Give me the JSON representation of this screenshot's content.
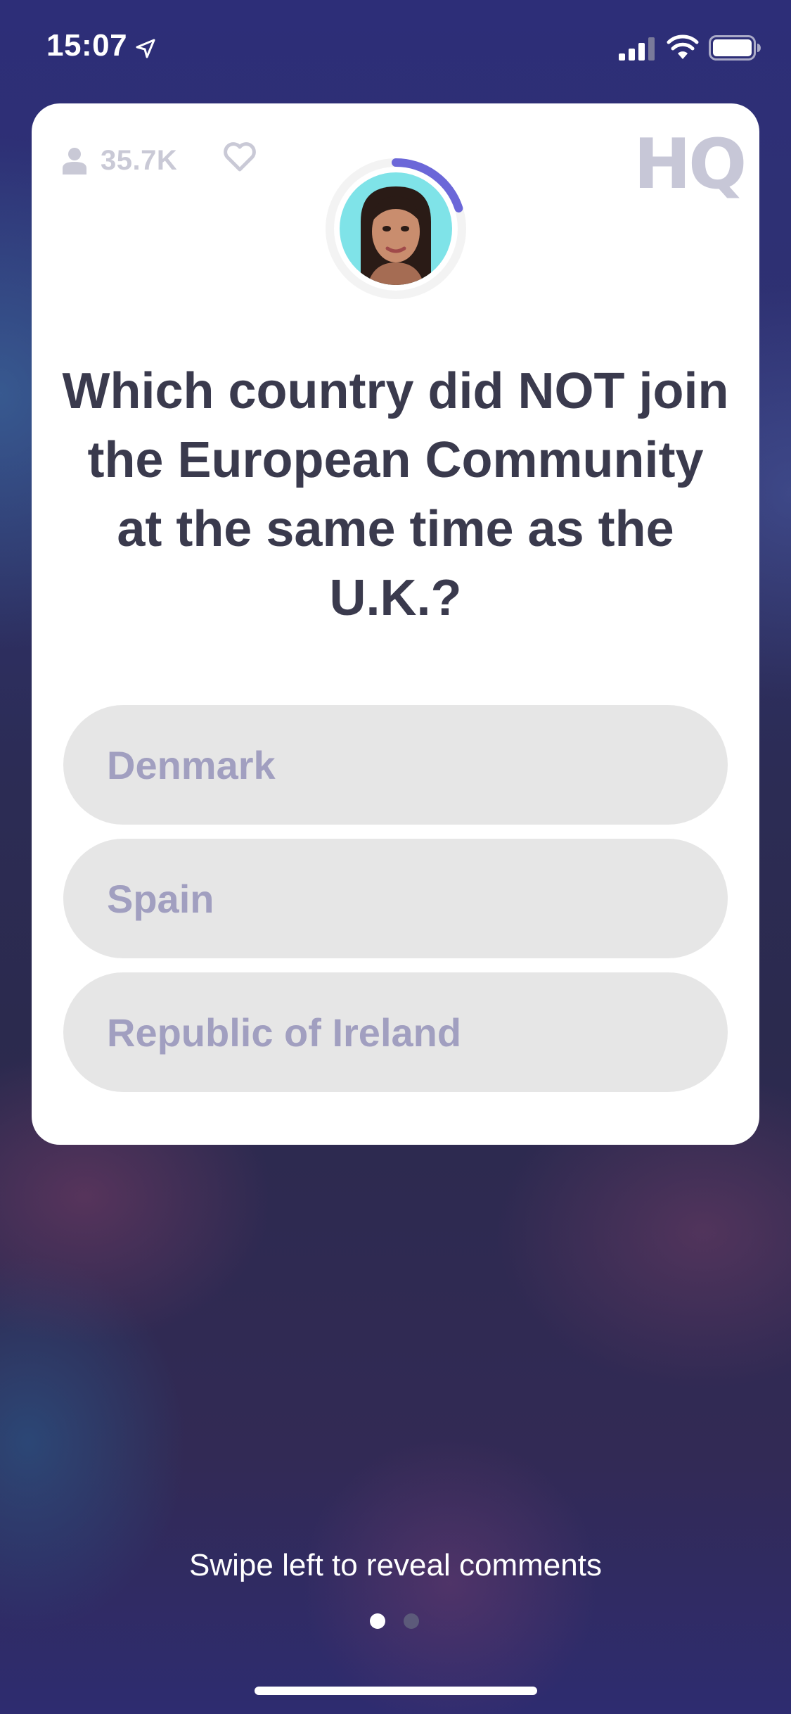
{
  "status_bar": {
    "time": "15:07",
    "icons": [
      "location-arrow-icon",
      "cellular-signal-icon",
      "wifi-icon",
      "battery-icon"
    ]
  },
  "card": {
    "viewer_count": "35.7K",
    "logo": "HQ",
    "timer_progress": 0.2,
    "question": "Which country did NOT join the European Community at the same time as the U.K.?",
    "answers": [
      "Denmark",
      "Spain",
      "Republic of Ireland"
    ]
  },
  "footer": {
    "swipe_hint": "Swipe left to reveal comments",
    "page_count": 2,
    "active_page": 1
  },
  "colors": {
    "accent": "#6b67d8",
    "question_text": "#3a3a4d",
    "answer_text": "#a19fc0",
    "answer_bg": "#e6e6e6",
    "logo": "#c7c7d7"
  }
}
